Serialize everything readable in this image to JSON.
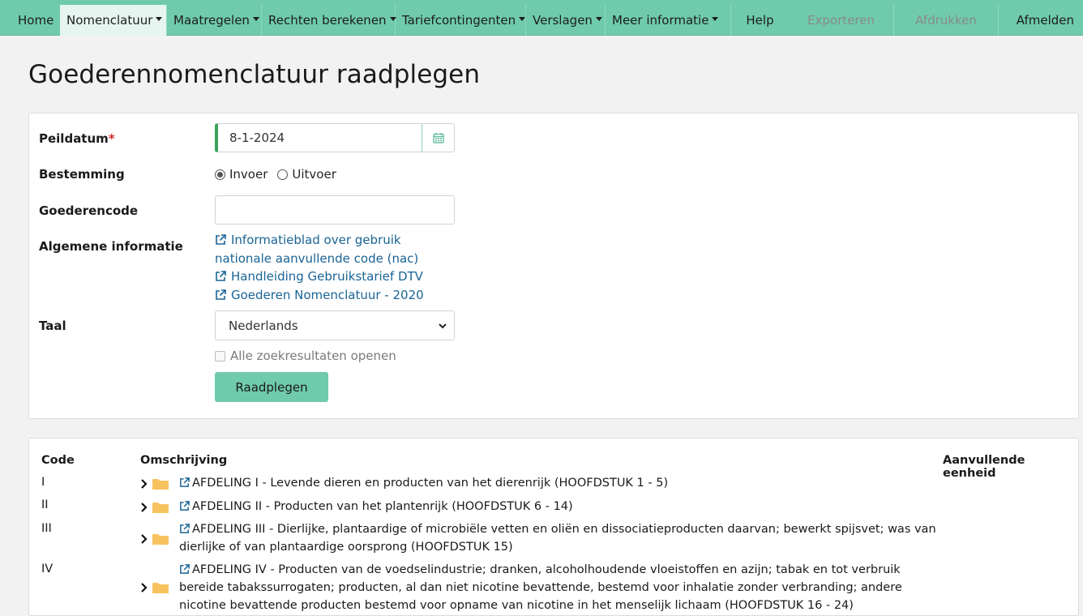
{
  "nav": {
    "home": "Home",
    "nomenclatuur": "Nomenclatuur",
    "maatregelen": "Maatregelen",
    "rechten": "Rechten berekenen",
    "tariefcontingenten": "Tariefcontingenten",
    "verslagen": "Verslagen",
    "meer_informatie": "Meer informatie",
    "help": "Help",
    "exporteren": "Exporteren",
    "afdrukken": "Afdrukken",
    "afmelden": "Afmelden"
  },
  "page_title": "Goederennomenclatuur raadplegen",
  "form": {
    "peildatum_label": "Peildatum",
    "required_mark": "*",
    "peildatum_value": "8-1-2024",
    "bestemming_label": "Bestemming",
    "invoer_label": "Invoer",
    "uitvoer_label": "Uitvoer",
    "bestemming_selected": "Invoer",
    "goederencode_label": "Goederencode",
    "goederencode_value": "",
    "algemene_label": "Algemene informatie",
    "links": [
      "Informatieblad over gebruik nationale aanvullende code (nac)",
      "Handleiding Gebruikstarief DTV",
      "Goederen Nomenclatuur - 2020"
    ],
    "taal_label": "Taal",
    "taal_value": "Nederlands",
    "alle_label": "Alle zoekresultaten openen",
    "raadplegen_label": "Raadplegen"
  },
  "results": {
    "headers": {
      "code": "Code",
      "omschrijving": "Omschrijving",
      "eenheid": "Aanvullende eenheid"
    },
    "rows": [
      {
        "code": "I",
        "desc": "AFDELING I - Levende dieren en producten van het dierenrijk (HOOFDSTUK 1 - 5)"
      },
      {
        "code": "II",
        "desc": "AFDELING II - Producten van het plantenrijk (HOOFDSTUK 6 - 14)"
      },
      {
        "code": "III",
        "desc": "AFDELING III - Dierlijke, plantaardige of microbiële vetten en oliën en dissociatieproducten daarvan; bewerkt spijsvet; was van dierlijke of van plantaardige oorsprong (HOOFDSTUK 15)"
      },
      {
        "code": "IV",
        "desc": "AFDELING IV - Producten van de voedselindustrie; dranken, alcoholhoudende vloeistoffen en azijn; tabak en tot verbruik bereide tabakssurrogaten; producten, al dan niet nicotine bevattende, bestemd voor inhalatie zonder verbranding; andere nicotine bevattende producten bestemd voor opname van nicotine in het menselijk lichaam (HOOFDSTUK 16 - 24)"
      }
    ]
  },
  "colors": {
    "accent": "#6fcbab",
    "link": "#1a6496",
    "required": "#d9262c",
    "date_bar": "#3aa45c",
    "folder": "#f7c35f"
  }
}
